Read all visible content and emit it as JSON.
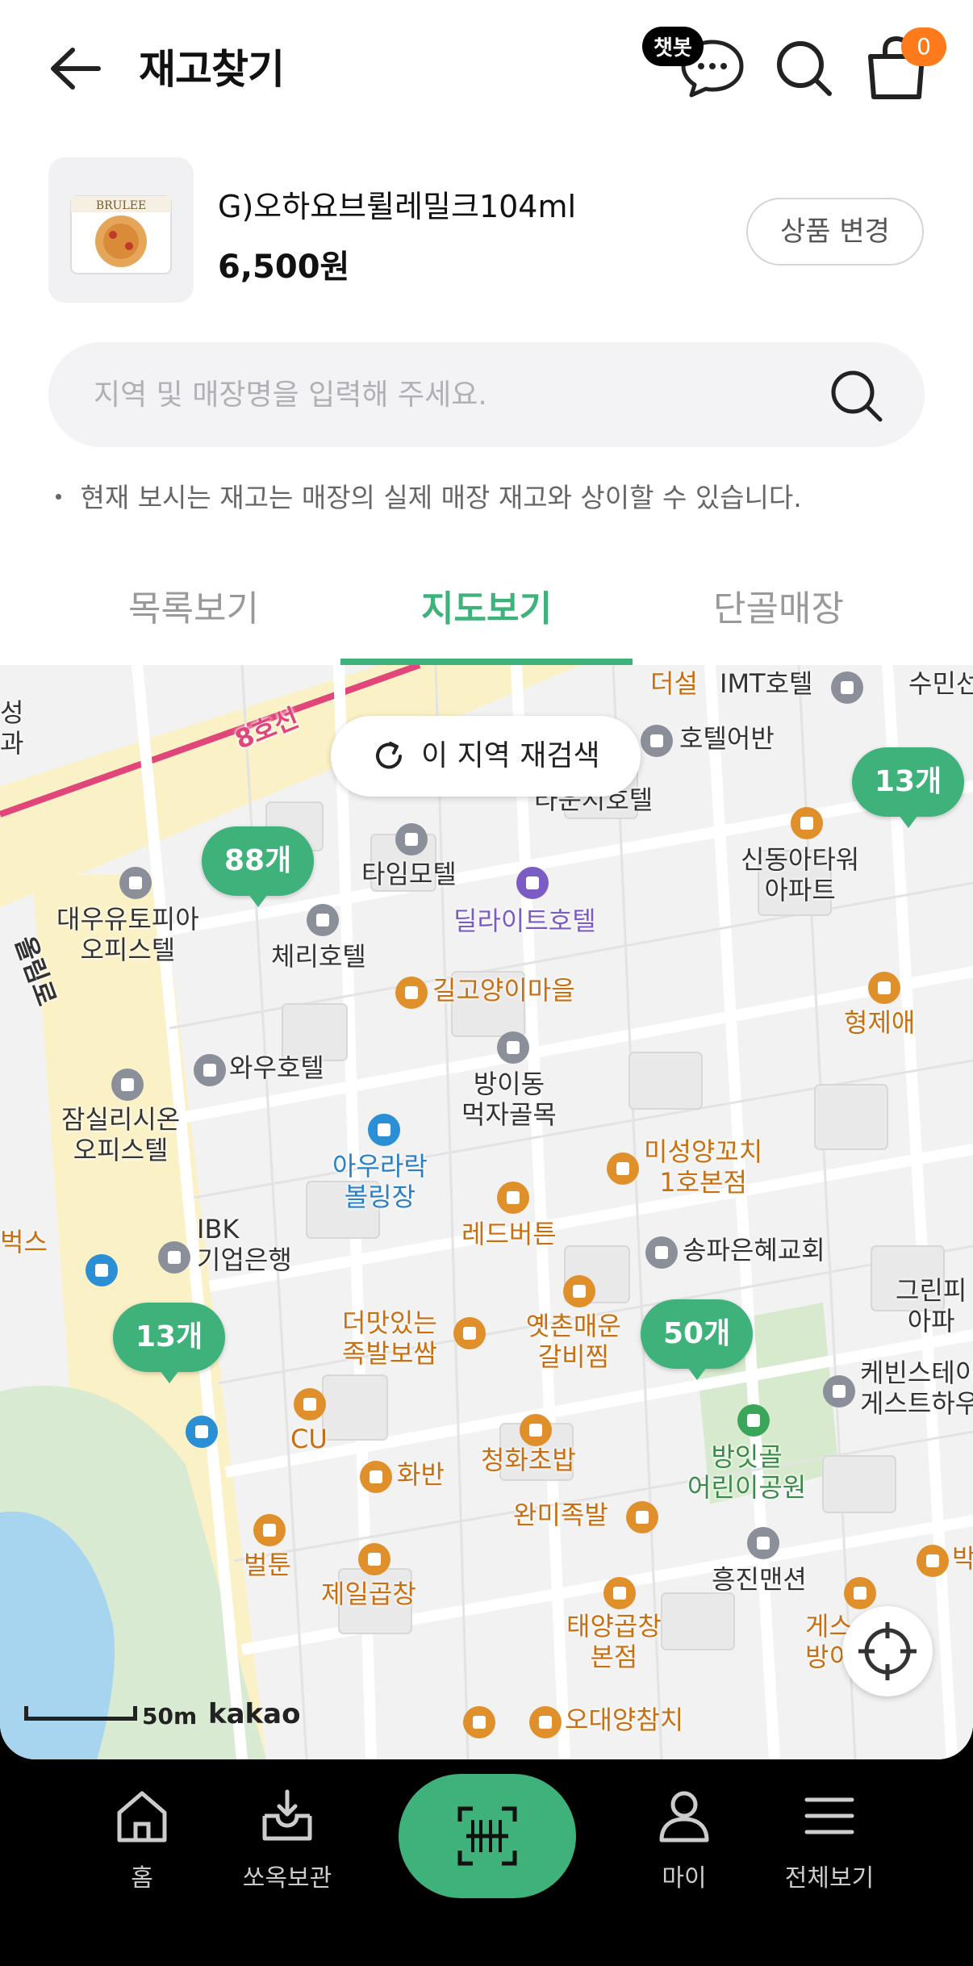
{
  "header": {
    "title": "재고찾기",
    "chatbot_badge": "챗봇",
    "cart_count": "0"
  },
  "product": {
    "thumb_text": "BRULEE",
    "name": "G)오하요브륄레밀크104ml",
    "price": "6,500원",
    "change_label": "상품 변경"
  },
  "search": {
    "placeholder": "지역 및 매장명을 입력해 주세요."
  },
  "notice": "・ 현재 보시는 재고는 매장의 실제 매장 재고와 상이할 수 있습니다.",
  "tabs": [
    {
      "label": "목록보기",
      "active": false
    },
    {
      "label": "지도보기",
      "active": true
    },
    {
      "label": "단골매장",
      "active": false
    }
  ],
  "map": {
    "research_label": "이 지역 재검색",
    "clusters": [
      "13개",
      "88개",
      "13개",
      "50개"
    ],
    "labels": {
      "line8": "8호선",
      "imt": "IMT호텔",
      "dulseol": "더설",
      "sumin": "수민선",
      "hotel_urban": "호텔어반",
      "tatun": "타운시호텔",
      "time_motel": "타임모텔",
      "delight": "딜라이트호텔",
      "cherry": "체리호텔",
      "daewoo": "대우유토피아\n오피스텔",
      "sindong": "신동아타워\n아파트",
      "cat": "길고양이마을",
      "hyeongje": "형제애",
      "wow": "와우호텔",
      "bangi": "방이동\n먹자골목",
      "jamsil": "잠실리시온\n오피스텔",
      "aura": "아우라락\n볼링장",
      "miseong": "미성양꼬치\n1호본점",
      "redbutton": "레드버튼",
      "ibk": "IBK\n기업은행",
      "songpa_church": "송파은혜교회",
      "green": "그린피\n아파",
      "daemat": "더맛있는\n족발보쌈",
      "yetchon": "옛촌매운\n갈비찜",
      "kevin": "케빈스테이\n게스트하우",
      "cu": "CU",
      "hwaban": "화반",
      "cheonghwa": "청화초밥",
      "bangit": "방잇골\n어린이공원",
      "wanmi": "완미족발",
      "beolteun": "벌툰",
      "jeil": "제일곱창",
      "heungjin": "흥진맨션",
      "taeyang": "태양곱창\n본점",
      "gyeseong": "게스\n방이",
      "odae": "오대양참치",
      "buks": "벅스",
      "seong": "성\n과",
      "ollimpic": "올림로",
      "bak": "박"
    },
    "scale_label": "50m",
    "provider": "kakao"
  },
  "bottom_nav": [
    {
      "label": "홈",
      "icon": "home-icon"
    },
    {
      "label": "쏘옥보관",
      "icon": "storage-icon"
    },
    {
      "label": "",
      "icon": "scan-icon"
    },
    {
      "label": "마이",
      "icon": "profile-icon"
    },
    {
      "label": "전체보기",
      "icon": "menu-icon"
    }
  ],
  "colors": {
    "accent": "#3fb17b",
    "cart_badge": "#ff7a1a",
    "poi_orange": "#c86f12",
    "poi_purple": "#7b5cc4",
    "poi_blue": "#2a7fc5"
  }
}
